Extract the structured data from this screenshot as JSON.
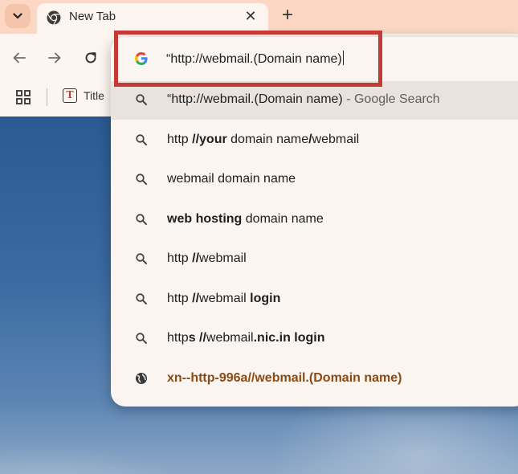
{
  "tab": {
    "title": "New Tab",
    "close_glyph": "✕",
    "new_tab_glyph": "+"
  },
  "bookmarks": {
    "item_label": "Title",
    "item_icon_letter": "T"
  },
  "omnibox": {
    "text": "“http://webmail.(Domain name)"
  },
  "suggestions": [
    {
      "parts": [
        {
          "t": "“http://webmail.(Domain name)",
          "b": false
        }
      ],
      "separator": " - ",
      "suffix": "Google Search",
      "icon": "search-icon",
      "selected": true
    },
    {
      "parts": [
        {
          "t": "http ",
          "b": false
        },
        {
          "t": "//your",
          "b": true
        },
        {
          "t": " domain name",
          "b": false
        },
        {
          "t": "/",
          "b": true
        },
        {
          "t": "webmail",
          "b": false
        }
      ],
      "icon": "search-icon"
    },
    {
      "parts": [
        {
          "t": "webmail domain name",
          "b": false
        }
      ],
      "icon": "search-icon"
    },
    {
      "parts": [
        {
          "t": "web hosting",
          "b": true
        },
        {
          "t": " domain name",
          "b": false
        }
      ],
      "icon": "search-icon"
    },
    {
      "parts": [
        {
          "t": "http ",
          "b": false
        },
        {
          "t": "//",
          "b": true
        },
        {
          "t": "webmail",
          "b": false
        }
      ],
      "icon": "search-icon"
    },
    {
      "parts": [
        {
          "t": "http ",
          "b": false
        },
        {
          "t": "//",
          "b": true
        },
        {
          "t": "webmail ",
          "b": false
        },
        {
          "t": "login",
          "b": true
        }
      ],
      "icon": "search-icon"
    },
    {
      "parts": [
        {
          "t": "http",
          "b": false
        },
        {
          "t": "s //",
          "b": true
        },
        {
          "t": "webmail",
          "b": false
        },
        {
          "t": ".nic.in login",
          "b": true
        }
      ],
      "icon": "search-icon"
    },
    {
      "parts": [
        {
          "t": "xn--http-996a//webmail.(Domain name)",
          "b": true
        }
      ],
      "icon": "globe-icon",
      "navigation": true
    }
  ],
  "colors": {
    "tab_strip": "#fbd7c4",
    "toolbar": "#fdf5ef",
    "highlight_box": "#c53a35",
    "nav_suggestion_text": "#8b4a14"
  }
}
